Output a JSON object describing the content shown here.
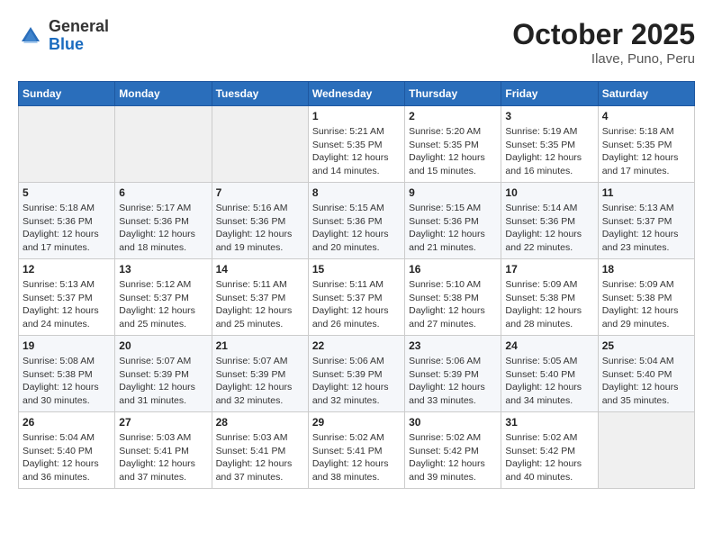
{
  "header": {
    "logo_line1": "General",
    "logo_line2": "Blue",
    "month": "October 2025",
    "location": "Ilave, Puno, Peru"
  },
  "days_of_week": [
    "Sunday",
    "Monday",
    "Tuesday",
    "Wednesday",
    "Thursday",
    "Friday",
    "Saturday"
  ],
  "weeks": [
    [
      {
        "day": "",
        "info": ""
      },
      {
        "day": "",
        "info": ""
      },
      {
        "day": "",
        "info": ""
      },
      {
        "day": "1",
        "info": "Sunrise: 5:21 AM\nSunset: 5:35 PM\nDaylight: 12 hours\nand 14 minutes."
      },
      {
        "day": "2",
        "info": "Sunrise: 5:20 AM\nSunset: 5:35 PM\nDaylight: 12 hours\nand 15 minutes."
      },
      {
        "day": "3",
        "info": "Sunrise: 5:19 AM\nSunset: 5:35 PM\nDaylight: 12 hours\nand 16 minutes."
      },
      {
        "day": "4",
        "info": "Sunrise: 5:18 AM\nSunset: 5:35 PM\nDaylight: 12 hours\nand 17 minutes."
      }
    ],
    [
      {
        "day": "5",
        "info": "Sunrise: 5:18 AM\nSunset: 5:36 PM\nDaylight: 12 hours\nand 17 minutes."
      },
      {
        "day": "6",
        "info": "Sunrise: 5:17 AM\nSunset: 5:36 PM\nDaylight: 12 hours\nand 18 minutes."
      },
      {
        "day": "7",
        "info": "Sunrise: 5:16 AM\nSunset: 5:36 PM\nDaylight: 12 hours\nand 19 minutes."
      },
      {
        "day": "8",
        "info": "Sunrise: 5:15 AM\nSunset: 5:36 PM\nDaylight: 12 hours\nand 20 minutes."
      },
      {
        "day": "9",
        "info": "Sunrise: 5:15 AM\nSunset: 5:36 PM\nDaylight: 12 hours\nand 21 minutes."
      },
      {
        "day": "10",
        "info": "Sunrise: 5:14 AM\nSunset: 5:36 PM\nDaylight: 12 hours\nand 22 minutes."
      },
      {
        "day": "11",
        "info": "Sunrise: 5:13 AM\nSunset: 5:37 PM\nDaylight: 12 hours\nand 23 minutes."
      }
    ],
    [
      {
        "day": "12",
        "info": "Sunrise: 5:13 AM\nSunset: 5:37 PM\nDaylight: 12 hours\nand 24 minutes."
      },
      {
        "day": "13",
        "info": "Sunrise: 5:12 AM\nSunset: 5:37 PM\nDaylight: 12 hours\nand 25 minutes."
      },
      {
        "day": "14",
        "info": "Sunrise: 5:11 AM\nSunset: 5:37 PM\nDaylight: 12 hours\nand 25 minutes."
      },
      {
        "day": "15",
        "info": "Sunrise: 5:11 AM\nSunset: 5:37 PM\nDaylight: 12 hours\nand 26 minutes."
      },
      {
        "day": "16",
        "info": "Sunrise: 5:10 AM\nSunset: 5:38 PM\nDaylight: 12 hours\nand 27 minutes."
      },
      {
        "day": "17",
        "info": "Sunrise: 5:09 AM\nSunset: 5:38 PM\nDaylight: 12 hours\nand 28 minutes."
      },
      {
        "day": "18",
        "info": "Sunrise: 5:09 AM\nSunset: 5:38 PM\nDaylight: 12 hours\nand 29 minutes."
      }
    ],
    [
      {
        "day": "19",
        "info": "Sunrise: 5:08 AM\nSunset: 5:38 PM\nDaylight: 12 hours\nand 30 minutes."
      },
      {
        "day": "20",
        "info": "Sunrise: 5:07 AM\nSunset: 5:39 PM\nDaylight: 12 hours\nand 31 minutes."
      },
      {
        "day": "21",
        "info": "Sunrise: 5:07 AM\nSunset: 5:39 PM\nDaylight: 12 hours\nand 32 minutes."
      },
      {
        "day": "22",
        "info": "Sunrise: 5:06 AM\nSunset: 5:39 PM\nDaylight: 12 hours\nand 32 minutes."
      },
      {
        "day": "23",
        "info": "Sunrise: 5:06 AM\nSunset: 5:39 PM\nDaylight: 12 hours\nand 33 minutes."
      },
      {
        "day": "24",
        "info": "Sunrise: 5:05 AM\nSunset: 5:40 PM\nDaylight: 12 hours\nand 34 minutes."
      },
      {
        "day": "25",
        "info": "Sunrise: 5:04 AM\nSunset: 5:40 PM\nDaylight: 12 hours\nand 35 minutes."
      }
    ],
    [
      {
        "day": "26",
        "info": "Sunrise: 5:04 AM\nSunset: 5:40 PM\nDaylight: 12 hours\nand 36 minutes."
      },
      {
        "day": "27",
        "info": "Sunrise: 5:03 AM\nSunset: 5:41 PM\nDaylight: 12 hours\nand 37 minutes."
      },
      {
        "day": "28",
        "info": "Sunrise: 5:03 AM\nSunset: 5:41 PM\nDaylight: 12 hours\nand 37 minutes."
      },
      {
        "day": "29",
        "info": "Sunrise: 5:02 AM\nSunset: 5:41 PM\nDaylight: 12 hours\nand 38 minutes."
      },
      {
        "day": "30",
        "info": "Sunrise: 5:02 AM\nSunset: 5:42 PM\nDaylight: 12 hours\nand 39 minutes."
      },
      {
        "day": "31",
        "info": "Sunrise: 5:02 AM\nSunset: 5:42 PM\nDaylight: 12 hours\nand 40 minutes."
      },
      {
        "day": "",
        "info": ""
      }
    ]
  ]
}
